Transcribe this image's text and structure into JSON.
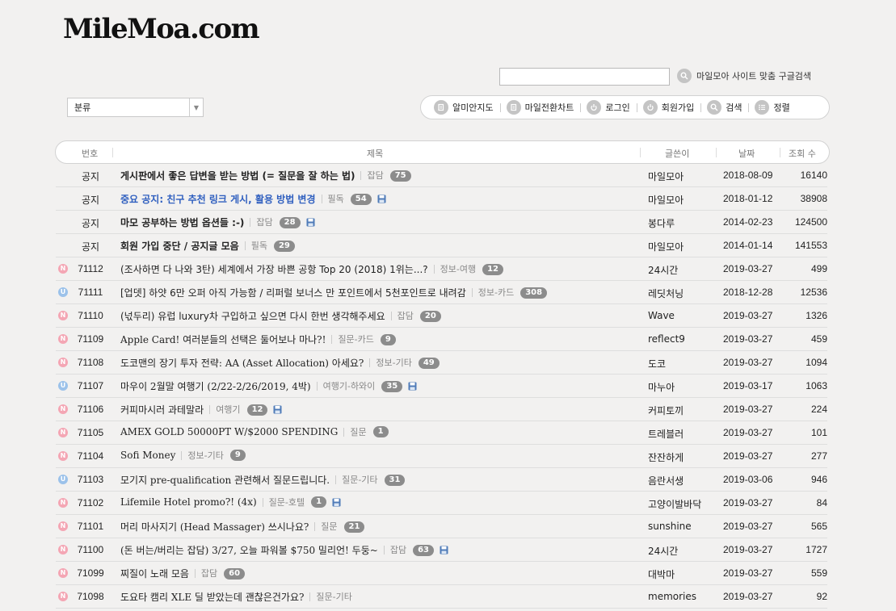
{
  "logo": "MileMoa.com",
  "search": {
    "value": "",
    "button_label": "마일모아 사이트 맞춤 구글검색",
    "icon": "search-icon"
  },
  "category_select": {
    "selected": "분류"
  },
  "toolbar": [
    {
      "label": "알미안지도",
      "icon": "document-icon"
    },
    {
      "label": "마일전환차트",
      "icon": "document-icon"
    },
    {
      "label": "로그인",
      "icon": "power-icon"
    },
    {
      "label": "회원가입",
      "icon": "power-icon"
    },
    {
      "label": "검색",
      "icon": "search-icon"
    },
    {
      "label": "정렬",
      "icon": "list-icon"
    }
  ],
  "table_header": {
    "number": "번호",
    "title": "제목",
    "author": "글쓴이",
    "date": "날짜",
    "views": "조회 수"
  },
  "colors": {
    "blue_title": "#2f5fbf",
    "badge_new": "#f4a6b4",
    "badge_updated": "#9cc2ea",
    "count_bg": "#8c8c8c"
  },
  "rows": [
    {
      "badge": "",
      "number": "공지",
      "title": "게시판에서 좋은 답변을 받는 방법 (= 질문을 잘 하는 법)",
      "style": "bold",
      "category": "잡담",
      "count": "75",
      "attach": false,
      "author": "마일모아",
      "date": "2018-08-09",
      "views": "16140"
    },
    {
      "badge": "",
      "number": "공지",
      "title": "중요 공지: 친구 추천 링크 게시, 활용 방법 변경",
      "style": "blue",
      "category": "필독",
      "count": "54",
      "attach": true,
      "author": "마일모아",
      "date": "2018-01-12",
      "views": "38908"
    },
    {
      "badge": "",
      "number": "공지",
      "title": "마모 공부하는 방법 옵션들 :-)",
      "style": "bold",
      "category": "잡담",
      "count": "28",
      "attach": true,
      "author": "봉다루",
      "date": "2014-02-23",
      "views": "124500"
    },
    {
      "badge": "",
      "number": "공지",
      "title": "회원 가입 중단 / 공지글 모음",
      "style": "bold",
      "category": "필독",
      "count": "29",
      "attach": false,
      "author": "마일모아",
      "date": "2014-01-14",
      "views": "141553"
    },
    {
      "badge": "N",
      "number": "71112",
      "title": "(조사하면 다 나와 3탄) 세계에서 가장 바쁜 공항 Top 20 (2018) 1위는...?",
      "style": "normal",
      "category": "정보-여행",
      "count": "12",
      "attach": false,
      "author": "24시간",
      "date": "2019-03-27",
      "views": "499"
    },
    {
      "badge": "U",
      "number": "71111",
      "title": "[업뎃] 하얏 6만 오퍼 아직 가능함 / 리퍼럴 보너스 만 포인트에서 5천포인트로 내려감",
      "style": "normal",
      "category": "정보-카드",
      "count": "308",
      "attach": false,
      "author": "레딧처닝",
      "date": "2018-12-28",
      "views": "12536"
    },
    {
      "badge": "N",
      "number": "71110",
      "title": "(넋두리) 유럽 luxury차 구입하고 싶으면 다시 한번 생각해주세요",
      "style": "normal",
      "category": "잡담",
      "count": "20",
      "attach": false,
      "author": "Wave",
      "date": "2019-03-27",
      "views": "1326"
    },
    {
      "badge": "N",
      "number": "71109",
      "title": "Apple Card! 여러분들의 선택은 둘어보나 마나?!",
      "style": "serif",
      "category": "질문-카드",
      "count": "9",
      "attach": false,
      "author": "reflect9",
      "date": "2019-03-27",
      "views": "459"
    },
    {
      "badge": "N",
      "number": "71108",
      "title": "도코맨의 장기 투자 전략: AA (Asset Allocation) 아세요?",
      "style": "serif",
      "category": "정보-기타",
      "count": "49",
      "attach": false,
      "author": "도코",
      "date": "2019-03-27",
      "views": "1094"
    },
    {
      "badge": "U",
      "number": "71107",
      "title": "마우이 2월말 여행기 (2/22-2/26/2019, 4박)",
      "style": "serif",
      "category": "여행기-하와이",
      "count": "35",
      "attach": true,
      "author": "마누아",
      "date": "2019-03-17",
      "views": "1063"
    },
    {
      "badge": "N",
      "number": "71106",
      "title": "커피마시러 과테말라",
      "style": "normal",
      "category": "여행기",
      "count": "12",
      "attach": true,
      "author": "커피토끼",
      "date": "2019-03-27",
      "views": "224"
    },
    {
      "badge": "N",
      "number": "71105",
      "title": "AMEX GOLD 50000PT W/$2000 SPENDING",
      "style": "serif",
      "category": "질문",
      "count": "1",
      "attach": false,
      "author": "트레블러",
      "date": "2019-03-27",
      "views": "101"
    },
    {
      "badge": "N",
      "number": "71104",
      "title": "Sofi Money",
      "style": "serif",
      "category": "정보-기타",
      "count": "9",
      "attach": false,
      "author": "잔잔하게",
      "date": "2019-03-27",
      "views": "277"
    },
    {
      "badge": "U",
      "number": "71103",
      "title": "모기지 pre-qualification 관련해서 질문드립니다.",
      "style": "serif",
      "category": "질문-기타",
      "count": "31",
      "attach": false,
      "author": "음란서생",
      "date": "2019-03-06",
      "views": "946"
    },
    {
      "badge": "N",
      "number": "71102",
      "title": "Lifemile Hotel promo?! (4x)",
      "style": "serif",
      "category": "질문-호텔",
      "count": "1",
      "attach": true,
      "author": "고양이발바닥",
      "date": "2019-03-27",
      "views": "84"
    },
    {
      "badge": "N",
      "number": "71101",
      "title": "머리 마사지기 (Head Massager) 쓰시나요?",
      "style": "serif",
      "category": "질문",
      "count": "21",
      "attach": false,
      "author": "sunshine",
      "date": "2019-03-27",
      "views": "565"
    },
    {
      "badge": "N",
      "number": "71100",
      "title": "(돈 버는/버리는 잡담) 3/27, 오늘 파워볼 $750 밀리언! 두둥~",
      "style": "serif",
      "category": "잡담",
      "count": "63",
      "attach": true,
      "author": "24시간",
      "date": "2019-03-27",
      "views": "1727"
    },
    {
      "badge": "N",
      "number": "71099",
      "title": "찌질이 노래 모음",
      "style": "normal",
      "category": "잡담",
      "count": "60",
      "attach": false,
      "author": "대박마",
      "date": "2019-03-27",
      "views": "559"
    },
    {
      "badge": "N",
      "number": "71098",
      "title": "도요타 캠리 XLE 딜 받았는데 괜찮은건가요?",
      "style": "serif",
      "category": "질문-기타",
      "count": "",
      "attach": false,
      "author": "memories",
      "date": "2019-03-27",
      "views": "92"
    }
  ]
}
